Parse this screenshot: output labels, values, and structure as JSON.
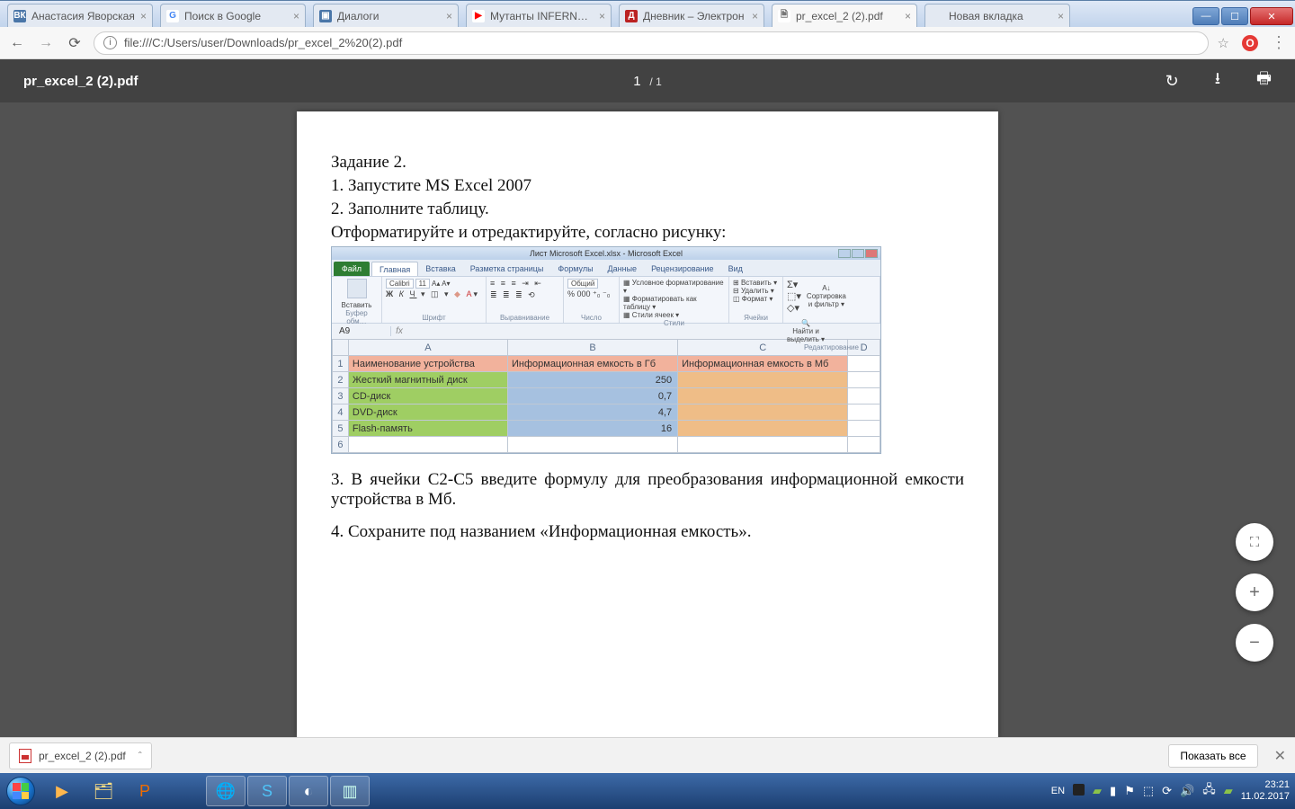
{
  "tabs": [
    {
      "icon_bg": "#4a76a8",
      "icon_fg": "#fff",
      "icon_text": "ВК",
      "label": "Анастасия Яворская"
    },
    {
      "icon_bg": "#fff",
      "icon_fg": "#4285f4",
      "icon_text": "G",
      "label": "Поиск в Google"
    },
    {
      "icon_bg": "#4a76a8",
      "icon_fg": "#fff",
      "icon_text": "▣",
      "label": "Диалоги"
    },
    {
      "icon_bg": "#fff",
      "icon_fg": "#f00",
      "icon_text": "▶",
      "label": "Мутанты INFERNO и"
    },
    {
      "icon_bg": "#b22",
      "icon_fg": "#fff",
      "icon_text": "Д",
      "label": "Дневник – Электрон"
    },
    {
      "icon_bg": "#fff",
      "icon_fg": "#777",
      "icon_text": "🗎",
      "label": "pr_excel_2 (2).pdf",
      "active": true
    },
    {
      "icon_bg": "transparent",
      "icon_fg": "#777",
      "icon_text": "",
      "label": "Новая вкладка"
    }
  ],
  "address": "file:///C:/Users/user/Downloads/pr_excel_2%20(2).pdf",
  "pdf": {
    "filename": "pr_excel_2 (2).pdf",
    "page_current": "1",
    "page_sep": "/",
    "page_total": "1"
  },
  "doc": {
    "title": "Задание 2.",
    "p1": "1. Запустите MS Excel 2007",
    "p2": "2. Заполните таблицу.",
    "p3": "Отформатируйте и отредактируйте, согласно рисунку:",
    "p4": "3. В ячейки С2-С5 введите формулу для преобразования информационной емкости устройства в Мб.",
    "p5": "4. Сохраните под названием «Информационная емкость»."
  },
  "excel": {
    "title": "Лист Microsoft Excel.xlsx - Microsoft Excel",
    "file_tab": "Файл",
    "tabs": [
      "Главная",
      "Вставка",
      "Разметка страницы",
      "Формулы",
      "Данные",
      "Рецензирование",
      "Вид"
    ],
    "groups": {
      "clipboard": "Буфер обм…",
      "font": "Шрифт",
      "align": "Выравнивание",
      "number": "Число",
      "styles": "Стили",
      "cells": "Ячейки",
      "editing": "Редактирование"
    },
    "font_name": "Calibri",
    "font_size": "11",
    "number_fmt": "Общий",
    "style_cmds": {
      "cond": "Условное форматирование ▾",
      "table": "Форматировать как таблицу ▾",
      "cell": "Стили ячеек ▾"
    },
    "cell_cmds": {
      "ins": "Вставить ▾",
      "del": "Удалить ▾",
      "fmt": "Формат ▾"
    },
    "edit_cmds": {
      "sort": "Сортировка\nи фильтр ▾",
      "find": "Найти и\nвыделить ▾"
    },
    "paste": "Вставить",
    "namebox": "A9",
    "cols": [
      "",
      "A",
      "B",
      "C",
      "D"
    ],
    "rows": [
      {
        "n": "1",
        "a": "Наименование устройства",
        "b": "Информационная емкость в Гб",
        "c": "Информационная емкость в Мб",
        "hdr": true
      },
      {
        "n": "2",
        "a": "Жесткий магнитный диск",
        "b": "250",
        "c": ""
      },
      {
        "n": "3",
        "a": "CD-диск",
        "b": "0,7",
        "c": ""
      },
      {
        "n": "4",
        "a": "DVD-диск",
        "b": "4,7",
        "c": ""
      },
      {
        "n": "5",
        "a": "Flash-память",
        "b": "16",
        "c": ""
      },
      {
        "n": "6",
        "blank": true
      }
    ]
  },
  "download": {
    "file": "pr_excel_2 (2).pdf",
    "show_all": "Показать все"
  },
  "tray": {
    "lang": "EN",
    "time": "23:21",
    "date": "11.02.2017"
  }
}
